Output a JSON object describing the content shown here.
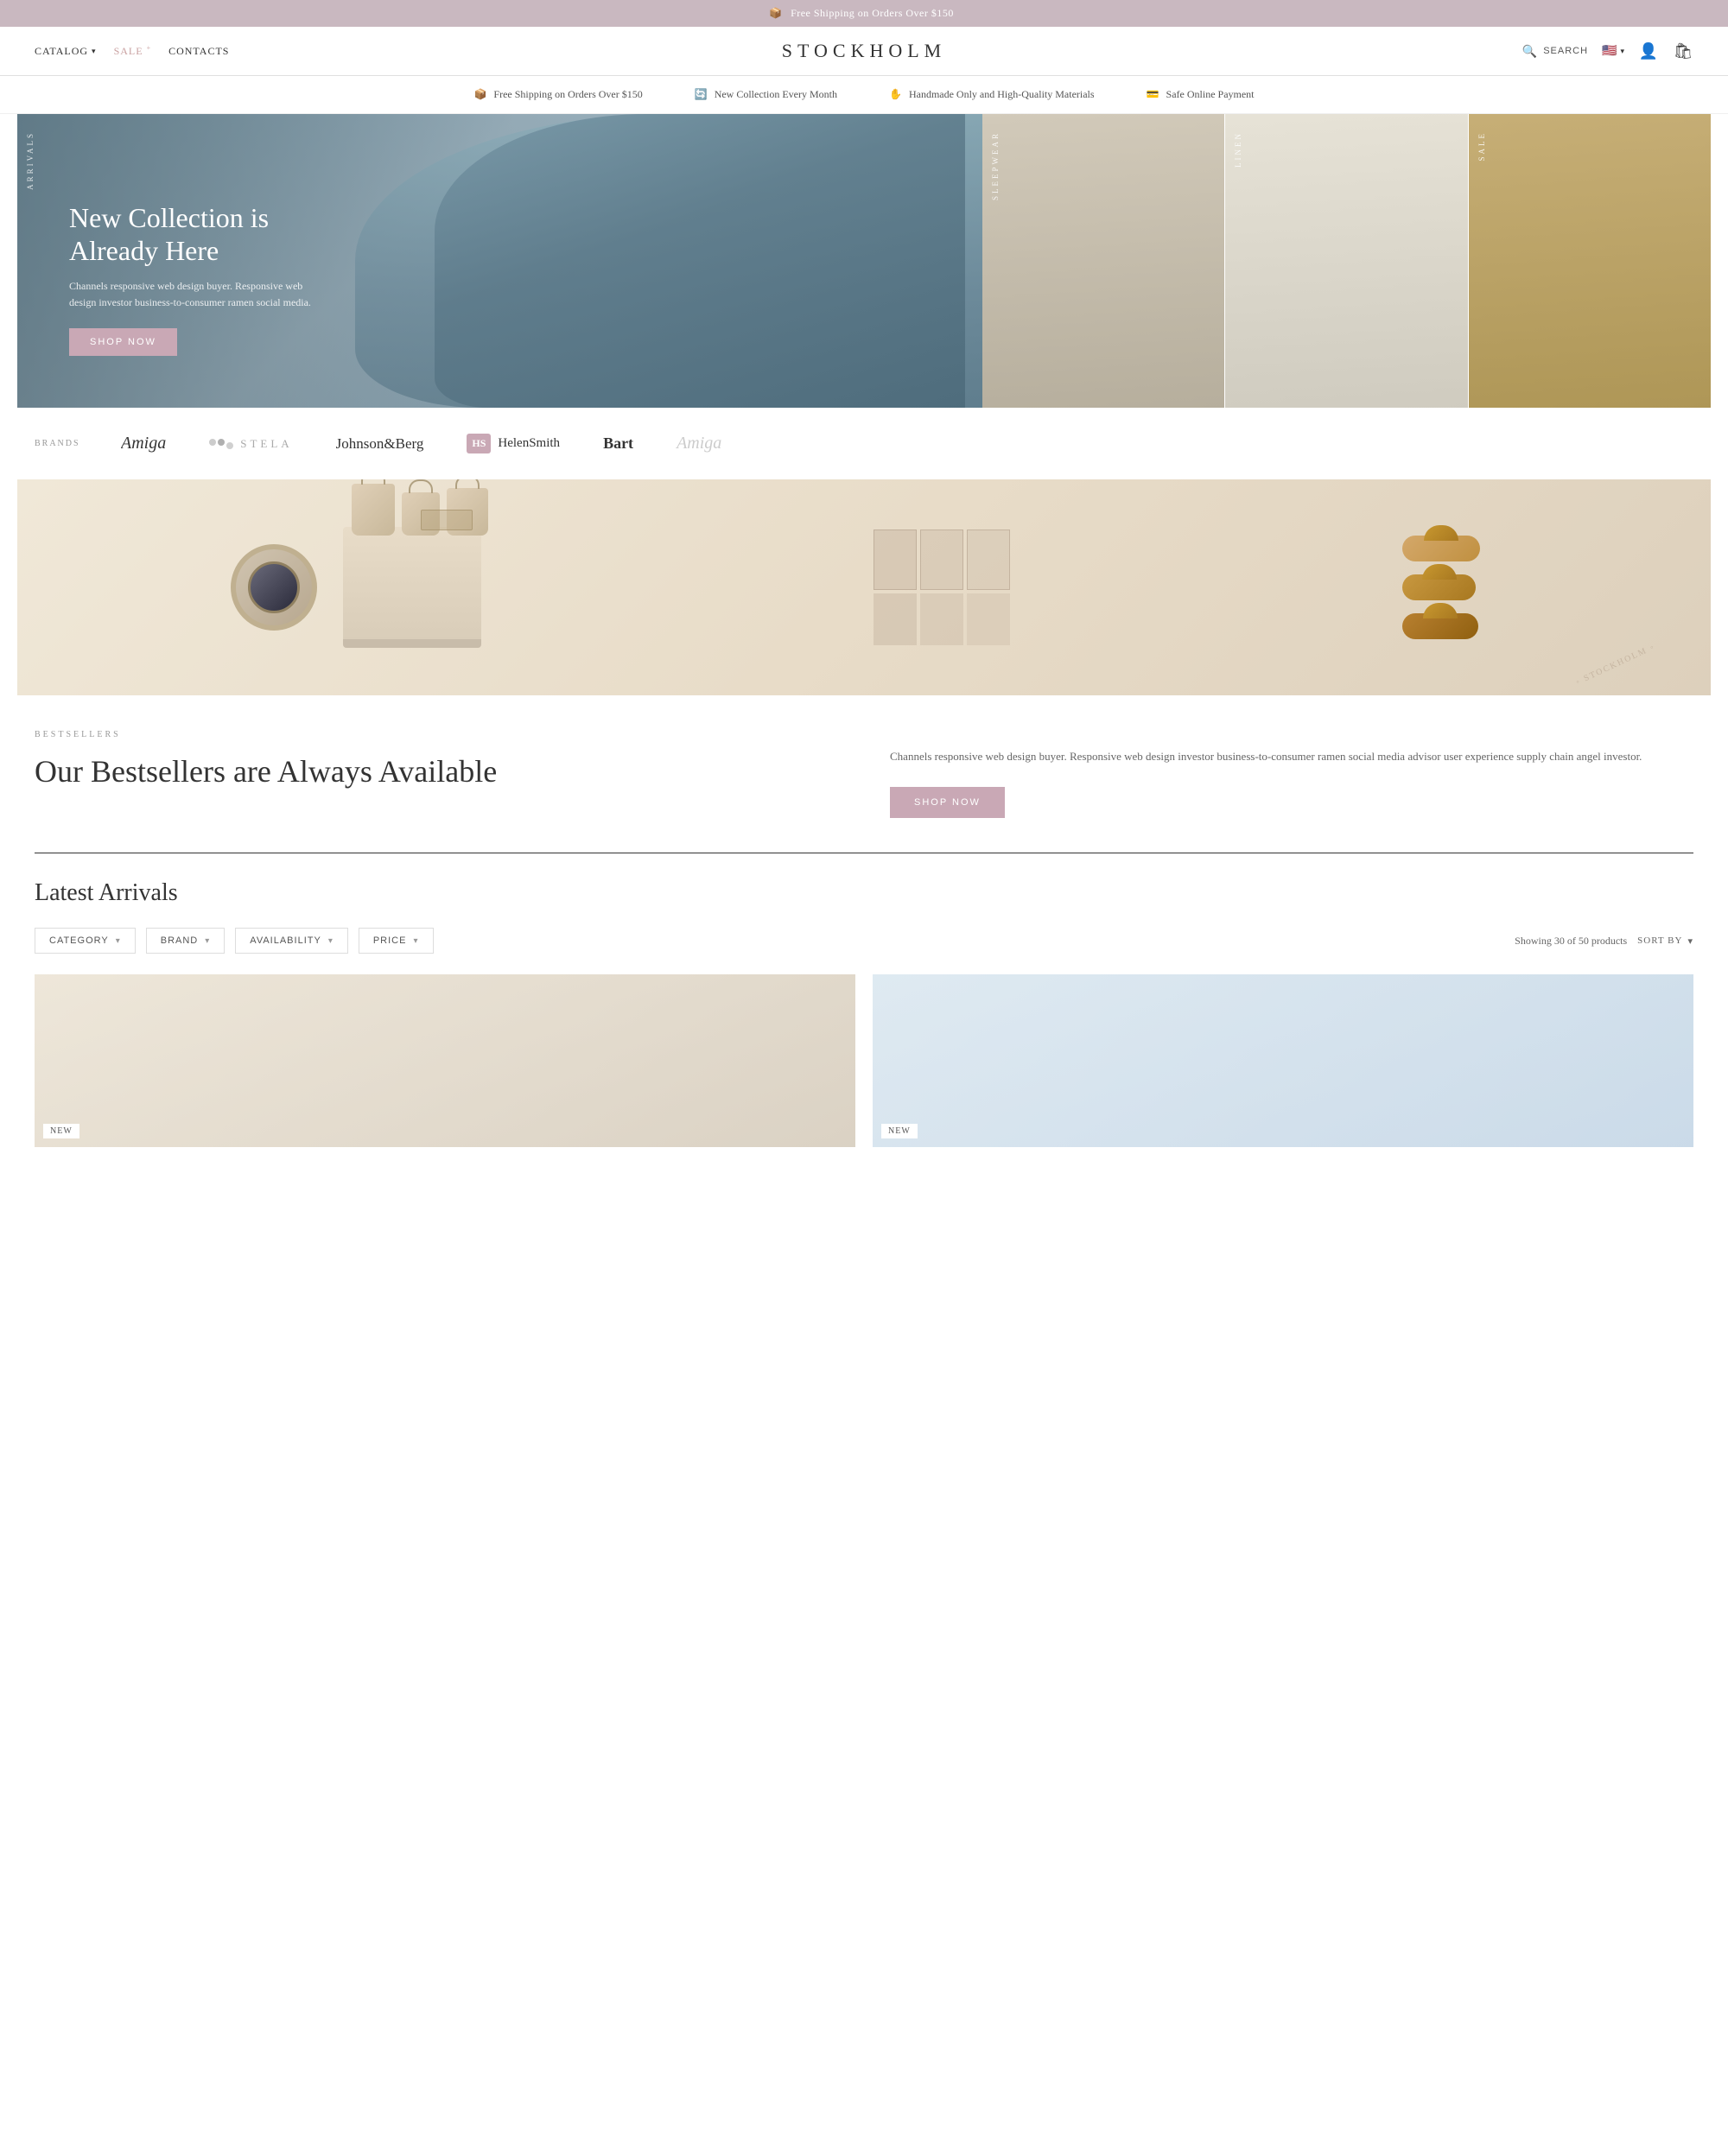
{
  "top_banner": {
    "icon": "📦",
    "text": "Free Shipping on Orders Over $150"
  },
  "header": {
    "nav_left": [
      {
        "id": "catalog",
        "label": "CATALOG",
        "has_dropdown": true
      },
      {
        "id": "sale",
        "label": "SALE",
        "has_badge": true
      },
      {
        "id": "contacts",
        "label": "CONTACTS"
      }
    ],
    "logo": "STOCKHOLM",
    "search_label": "SEARCH",
    "currency_flag": "🇺🇸"
  },
  "feature_bar": {
    "items": [
      {
        "id": "shipping",
        "icon": "📦",
        "text": "Free Shipping on Orders Over $150"
      },
      {
        "id": "collection",
        "icon": "🔄",
        "text": "New Collection Every Month"
      },
      {
        "id": "handmade",
        "icon": "✋",
        "text": "Handmade Only and High-Quality Materials"
      },
      {
        "id": "payment",
        "icon": "💳",
        "text": "Safe Online Payment"
      }
    ]
  },
  "hero": {
    "main": {
      "label": "ARRIVALS",
      "title": "New Collection is Already Here",
      "description": "Channels responsive web design buyer. Responsive web design investor business-to-consumer ramen social media.",
      "cta": "SHOP NOW"
    },
    "panels": [
      {
        "label": "SLEEPWEAR"
      },
      {
        "label": "LINEN"
      },
      {
        "label": "SALE"
      }
    ]
  },
  "brands": {
    "label": "BRANDS",
    "items": [
      {
        "id": "amiga1",
        "name": "Amiga",
        "style": "serif"
      },
      {
        "id": "stela",
        "name": "STELA",
        "has_dots": true
      },
      {
        "id": "johnson",
        "name": "Johnson&Berg",
        "style": "plain"
      },
      {
        "id": "helen",
        "name": "HelenSmith",
        "has_badge": true,
        "badge": "HS"
      },
      {
        "id": "bart",
        "name": "Bart",
        "style": "bold"
      },
      {
        "id": "amiga2",
        "name": "Amiga",
        "style": "serif"
      }
    ]
  },
  "bestsellers": {
    "tag": "BESTSELLERS",
    "title": "Our Bestsellers are Always Available",
    "description": "Channels responsive web design buyer. Responsive web design investor business-to-consumer ramen social media advisor user experience supply chain angel investor.",
    "cta": "SHOP NOW"
  },
  "latest": {
    "title": "Latest Arrivals",
    "filters": [
      {
        "id": "category",
        "label": "CATEGORY"
      },
      {
        "id": "brand",
        "label": "BRAND"
      },
      {
        "id": "availability",
        "label": "AVAILABILITY"
      },
      {
        "id": "price",
        "label": "PRICE"
      }
    ],
    "showing_text": "Showing 30 of 50 products",
    "sort_by": "SORT BY",
    "products": [
      {
        "id": "p1",
        "badge": "New",
        "bg": "warm"
      },
      {
        "id": "p2",
        "badge": "New",
        "bg": "cool"
      }
    ]
  },
  "watermark": "STOCKHOLM"
}
